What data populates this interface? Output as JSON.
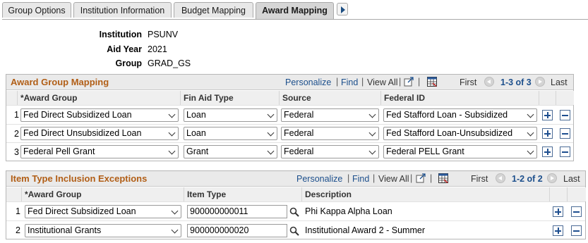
{
  "tabs": [
    {
      "label": "Group Options",
      "active": false
    },
    {
      "label": "Institution Information",
      "active": false
    },
    {
      "label": "Budget Mapping",
      "active": false
    },
    {
      "label": "Award Mapping",
      "active": true
    }
  ],
  "key_info": {
    "institution_label": "Institution",
    "institution_value": "PSUNV",
    "aid_year_label": "Aid Year",
    "aid_year_value": "2021",
    "group_label": "Group",
    "group_value": "GRAD_GS"
  },
  "award_group_mapping": {
    "title": "Award Group Mapping",
    "personalize": "Personalize",
    "find": "Find",
    "view_all": "View All",
    "first": "First",
    "range": "1-3 of 3",
    "last": "Last",
    "columns": [
      "*Award Group",
      "Fin Aid Type",
      "Source",
      "Federal ID"
    ],
    "rows": [
      {
        "num": "1",
        "award_group": "Fed Direct Subsidized Loan",
        "fin_aid_type": "Loan",
        "source": "Federal",
        "federal_id": "Fed Stafford Loan - Subsidized"
      },
      {
        "num": "2",
        "award_group": "Fed Direct Unsubsidized Loan",
        "fin_aid_type": "Loan",
        "source": "Federal",
        "federal_id": "Fed Stafford Loan-Unsubsidized"
      },
      {
        "num": "3",
        "award_group": "Federal Pell Grant",
        "fin_aid_type": "Grant",
        "source": "Federal",
        "federal_id": "Federal PELL Grant"
      }
    ]
  },
  "item_type_exceptions": {
    "title": "Item Type Inclusion Exceptions",
    "personalize": "Personalize",
    "find": "Find",
    "view_all": "View All",
    "first": "First",
    "range": "1-2 of 2",
    "last": "Last",
    "columns": [
      "*Award Group",
      "Item Type",
      "Description"
    ],
    "rows": [
      {
        "num": "1",
        "award_group": "Fed Direct Subsidized Loan",
        "item_type": "900000000011",
        "description": "Phi Kappa Alpha Loan"
      },
      {
        "num": "2",
        "award_group": "Institutional Grants",
        "item_type": "900000000020",
        "description": "Institutional Award 2 - Summer"
      }
    ]
  },
  "colors": {
    "grid_title": "#b15e16",
    "link": "#1c4f8c",
    "header_bg": "#eaeaea"
  }
}
